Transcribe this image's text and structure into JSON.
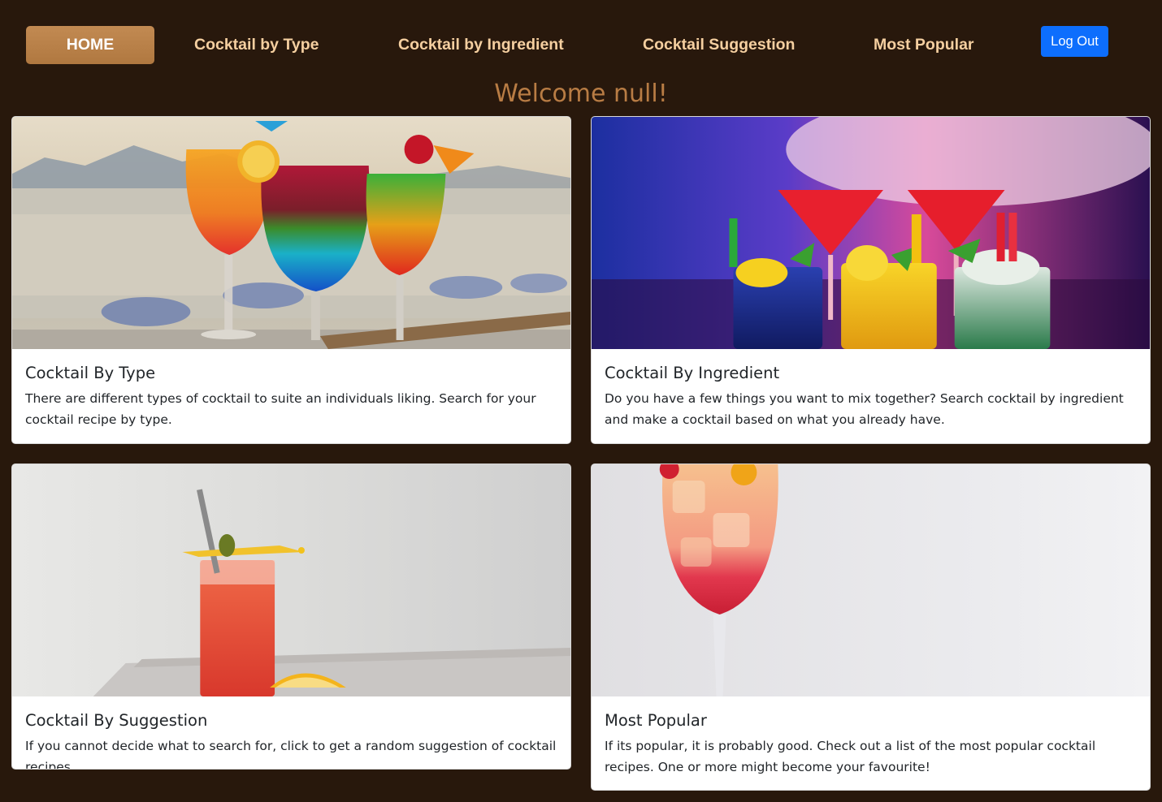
{
  "nav": {
    "home": "HOME",
    "by_type": "Cocktail by Type",
    "by_ingredient": "Cocktail by Ingredient",
    "suggestion": "Cocktail Suggestion",
    "popular": "Most Popular",
    "logout": "Log Out"
  },
  "welcome": "Welcome null!",
  "cards": [
    {
      "title": "Cocktail By Type",
      "text": "There are different types of cocktail to suite an individuals liking. Search for your cocktail recipe by type."
    },
    {
      "title": "Cocktail By Ingredient",
      "text": "Do you have a few things you want to mix together? Search cocktail by ingredient and make a cocktail based on what you already have."
    },
    {
      "title": "Cocktail By Suggestion",
      "text": "If you cannot decide what to search for, click to get a random suggestion of cocktail recipes."
    },
    {
      "title": "Most Popular",
      "text": "If its popular, it is probably good. Check out a list of the most popular cocktail recipes. One or more might become your favourite!"
    }
  ],
  "colors": {
    "background": "#28180c",
    "nav_text": "#f5cfa0",
    "active_nav": "#b8804a",
    "welcome": "#b87c44",
    "logout_button": "#0d6efd"
  }
}
